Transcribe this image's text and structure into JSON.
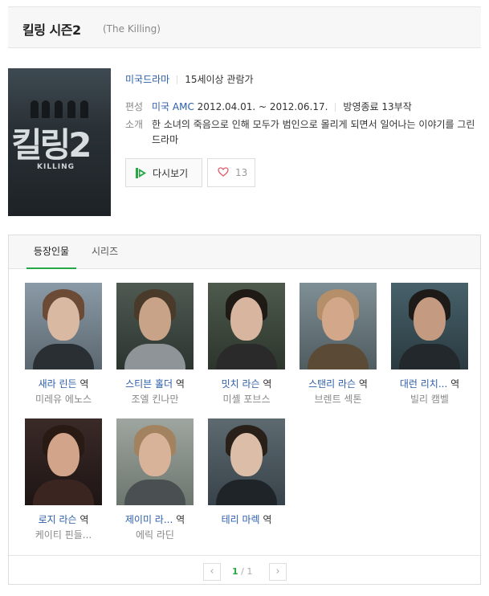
{
  "header": {
    "title": "킬링 시즌2",
    "original_title": "(The Killing)"
  },
  "poster": {
    "title_text": "킬링2",
    "subtitle_text": "KILLING"
  },
  "info": {
    "genre": "미국드라마",
    "rating": "15세이상 관람가",
    "broadcast_label": "편성",
    "broadcast_channel": "미국 AMC",
    "broadcast_period": "2012.04.01. ~ 2012.06.17.",
    "status": "방영종료 13부작",
    "summary_label": "소개",
    "summary": "한 소녀의 죽음으로 인해 모두가 범인으로 몰리게 되면서 일어나는 이야기를 그린 드라마"
  },
  "buttons": {
    "replay": "다시보기",
    "like_count": "13"
  },
  "tabs": [
    {
      "label": "등장인물"
    },
    {
      "label": "시리즈"
    }
  ],
  "cast": [
    {
      "role": "새라 린든",
      "suffix": " 역",
      "actor": "미레유 에노스"
    },
    {
      "role": "스티븐 홀더",
      "suffix": " 역",
      "actor": "조엘 킨나만"
    },
    {
      "role": "밋치 라슨",
      "suffix": " 역",
      "actor": "미셸 포브스"
    },
    {
      "role": "스탠리 라슨",
      "suffix": " 역",
      "actor": "브렌트 섹톤"
    },
    {
      "role": "대런 리치...",
      "suffix": " 역",
      "actor": "빌리 캠벨"
    },
    {
      "role": "로지 라슨",
      "suffix": " 역",
      "actor": "케이티 핀들..."
    },
    {
      "role": "제이미 라...",
      "suffix": " 역",
      "actor": "에릭 라딘"
    },
    {
      "role": "테리 마렉",
      "suffix": " 역",
      "actor": ""
    }
  ],
  "pagination": {
    "current": "1",
    "separator": "/",
    "total": "1",
    "prev": "‹",
    "next": "›"
  },
  "colors": {
    "accent_green": "#28a745",
    "link_blue": "#2b5da8"
  }
}
